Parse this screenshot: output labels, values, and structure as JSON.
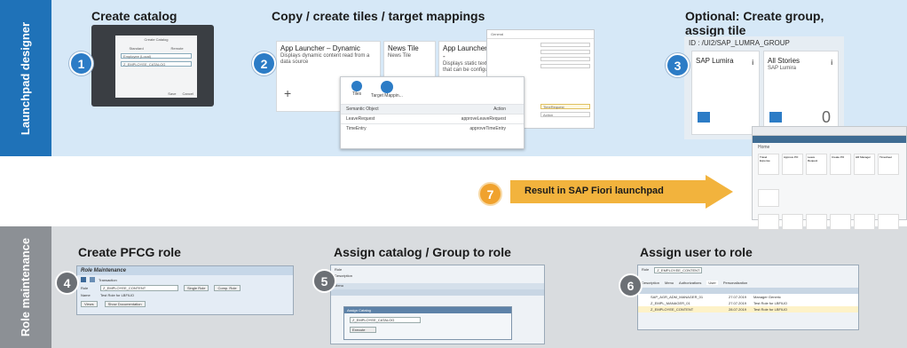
{
  "sections": {
    "top_label": "Launchpad designer",
    "bottom_label": "Role maintenance"
  },
  "steps": {
    "create_catalog": {
      "num": "1",
      "title": "Create catalog"
    },
    "copy_tiles": {
      "num": "2",
      "title": "Copy / create tiles / target mappings"
    },
    "create_group": {
      "num": "3",
      "title_line1": "Optional: Create group,",
      "title_line2": "assign tile"
    },
    "pfcg_role": {
      "num": "4",
      "title": "Create PFCG role"
    },
    "assign_catalog": {
      "num": "5",
      "title": "Assign catalog / Group to role"
    },
    "assign_user": {
      "num": "6",
      "title": "Assign user to role"
    },
    "result": {
      "num": "7",
      "title": "Result in SAP Fiori launchpad"
    }
  },
  "catalog_dialog": {
    "title": "Create Catalog",
    "standard": "Standard",
    "remote": "Remote",
    "field1": "Employee (Local)",
    "field2": "Z_EMPLOYEE_CATALOG",
    "save": "Save",
    "cancel": "Cancel"
  },
  "tiles": [
    {
      "title": "App Launcher – Dynamic",
      "sub": "Displays dynamic content read from a data source"
    },
    {
      "title": "News Tile",
      "sub": "News Tile"
    },
    {
      "title": "App Launcher -",
      "sub": "Displays static text that can be configu"
    }
  ],
  "mapping_popup": {
    "icon1": "Tiles",
    "icon2": "Target Mappin...",
    "col1": "Semantic Object",
    "col2": "Action",
    "rows": [
      {
        "obj": "LeaveRequest",
        "action": "approveLeaveRequest"
      },
      {
        "obj": "TimeEntry",
        "action": "approveTimeEntry"
      }
    ]
  },
  "general_panel": {
    "title": "General",
    "value1": "TimeRequest",
    "value2": "Action"
  },
  "group": {
    "id": "ID : /UI2/SAP_LUMRA_GROUP",
    "tile1": "SAP Lumira",
    "tile2": "All Stories",
    "tile2_sub": "SAP Lumira",
    "count": "0"
  },
  "pfcg": {
    "title": "Role Maintenance",
    "transaction": "Transaction",
    "role_label": "Role",
    "role_value": "Z_EMPLOYEE_CONTENT",
    "single_role": "Single Role",
    "comp_role": "Comp. Role",
    "name_label": "Name",
    "name_value": "Test Role for LBFIUO",
    "views": "Views",
    "show_docs": "Show Documentation"
  },
  "assign_catalog_win": {
    "role": "Role",
    "desc": "Description",
    "tab": "Menu",
    "popup_title": "Assign Catalog",
    "catalog_id": "Z_EMPLOYEE_CATALOG",
    "button": "Execute"
  },
  "assign_user_win": {
    "role_label": "Role",
    "role_value": "Z_EMPLOYEE_CONTENT",
    "tabs": [
      "Description",
      "Menu",
      "Authorizations",
      "User",
      "Personalization"
    ],
    "rows": [
      {
        "user": "SAP_AGR_ADM_MANAGER_01",
        "date": "27.07.2019",
        "name": "Manager Generic"
      },
      {
        "user": "Z_EMPL_MANAGER_01",
        "date": "27.07.2019",
        "name": "Test Role for LBFIUO"
      },
      {
        "user": "Z_EMPLOYEE_CONTENT",
        "date": "28.07.2019",
        "name": "Test Role for LBFIUO"
      }
    ]
  },
  "fiori": {
    "header": "Home",
    "tile_labels": [
      "Travel Expense",
      "Approve PO",
      "Leave Request",
      "Create PO",
      "HR Manager",
      "Timesheet"
    ]
  },
  "colors": {
    "accent_blue": "#1f72b8",
    "step_orange": "#f0a22e",
    "arrow_yellow": "#f2b33d"
  }
}
